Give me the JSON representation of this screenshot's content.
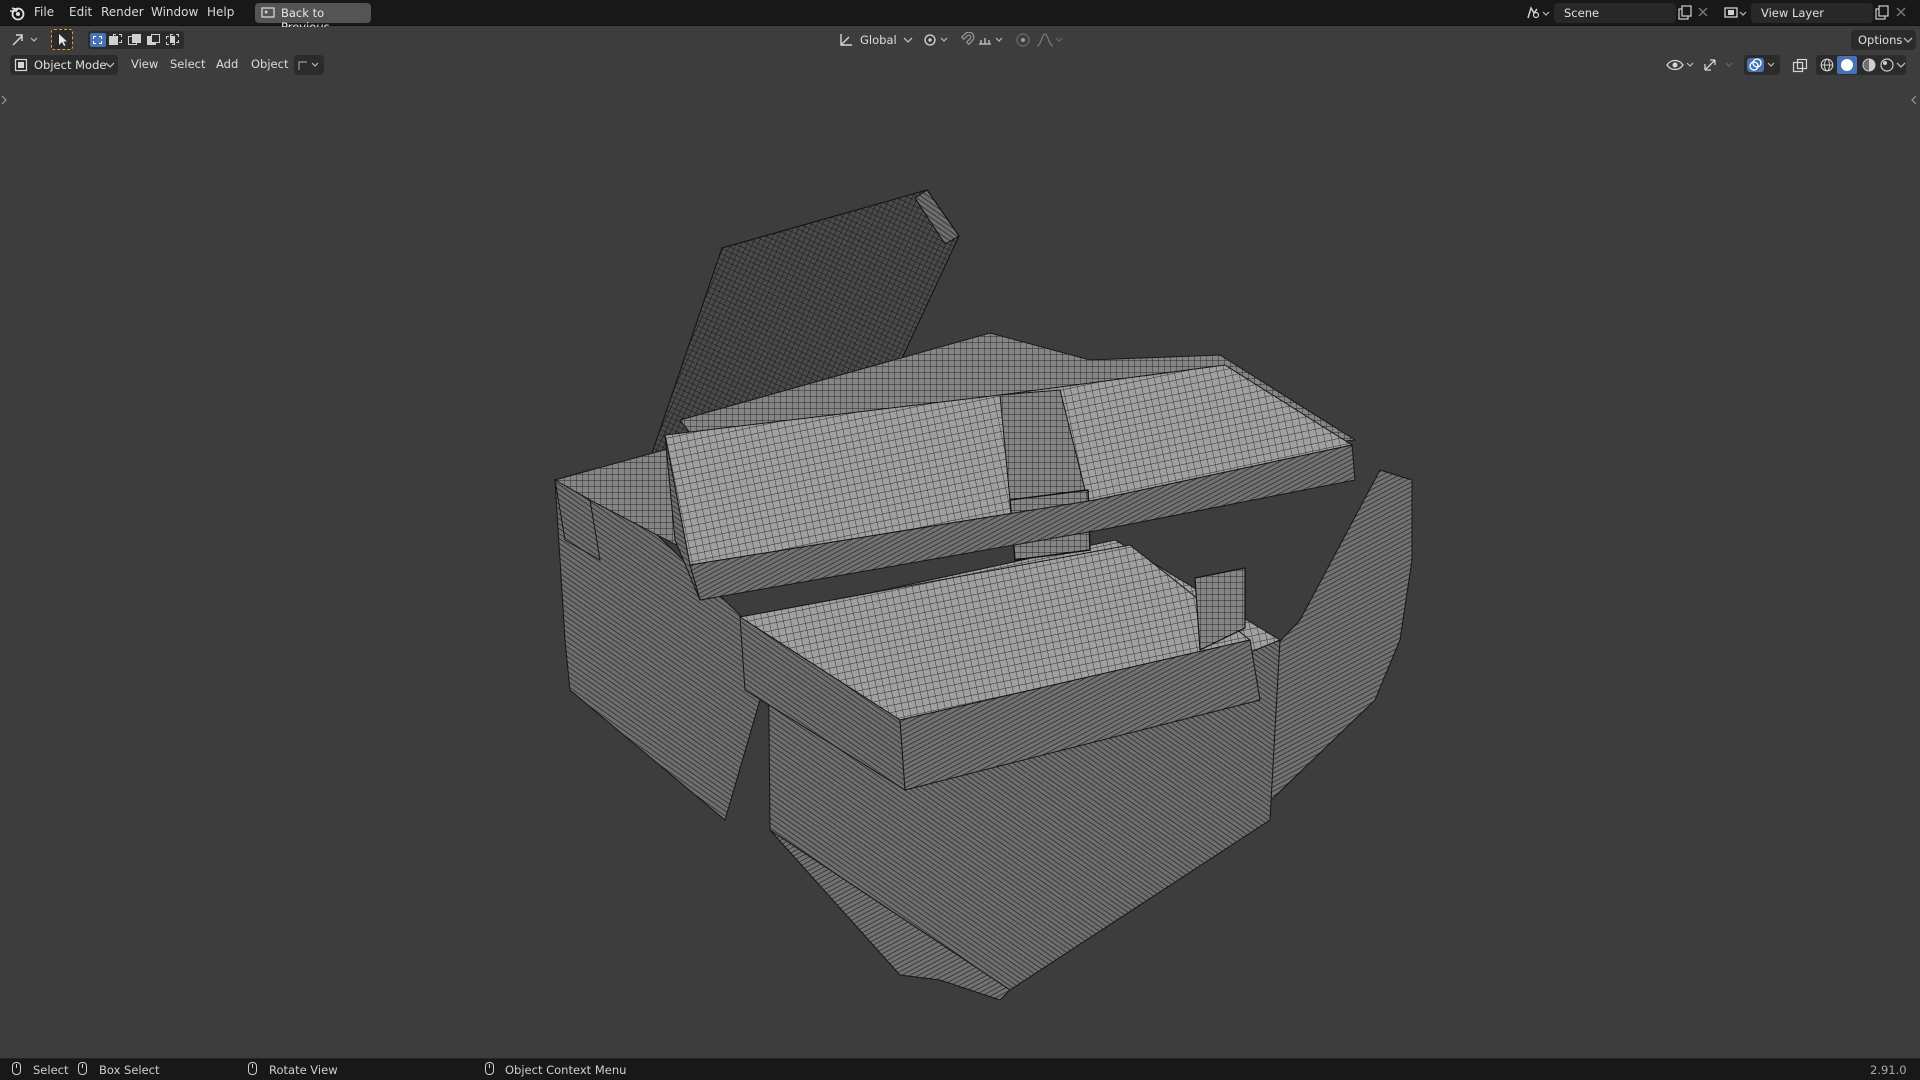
{
  "topbar": {
    "menu": [
      "File",
      "Edit",
      "Render",
      "Window",
      "Help"
    ],
    "back_button": "Back to Previous",
    "scene_name": "Scene",
    "view_layer_name": "View Layer"
  },
  "tool_header": {
    "transform_orientation": "Global",
    "options_label": "Options"
  },
  "viewport_header": {
    "mode": "Object Mode",
    "menus": [
      "View",
      "Select",
      "Add",
      "Object"
    ]
  },
  "statusbar": {
    "select": "Select",
    "box_select": "Box Select",
    "rotate_view": "Rotate View",
    "context_menu": "Object Context Menu",
    "version": "2.91.0"
  },
  "colors": {
    "topbar_bg": "#181818",
    "viewport_bg": "#3d3d3d",
    "accent_blue": "#4772b3",
    "active_tool": "#e0a030",
    "wire": "#1a1a1a",
    "mesh_face": "#8a8a8a"
  },
  "icons": {
    "blender_logo": "blender-logo-icon",
    "editor_type": "3d-viewport-icon",
    "select_tool": "cursor-select-icon",
    "scene": "scene-icon",
    "view_layer": "view-layer-icon",
    "pivot": "pivot-icon",
    "snap": "magnet-icon",
    "proportional": "proportional-edit-icon",
    "visibility": "eye-icon",
    "gizmo": "gizmo-icon",
    "overlay": "overlay-icon",
    "xray": "xray-icon",
    "shading": [
      "wireframe-shading-icon",
      "solid-shading-icon",
      "material-shading-icon",
      "rendered-shading-icon"
    ]
  }
}
